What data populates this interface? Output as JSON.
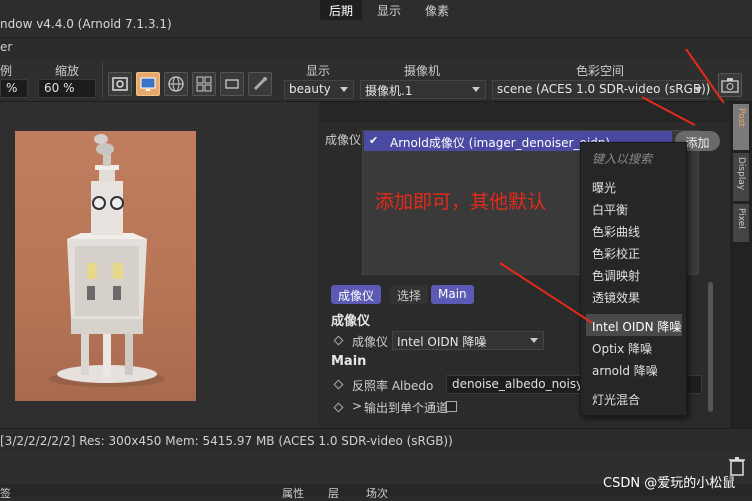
{
  "window": {
    "title": "ndow v4.4.0 (Arnold 7.1.3.1)"
  },
  "menubar": {
    "item": "er"
  },
  "toolbar": {
    "label_ratio": "例",
    "label_zoom": "缩放",
    "ratio_value": "%",
    "zoom_value": "60 %",
    "label_display": "显示",
    "label_camera": "摄像机",
    "label_colorspace": "色彩空间",
    "display_value": "beauty",
    "camera_value": "摄像机.1",
    "colorspace_value": "scene (ACES 1.0 SDR-video (sRGB))"
  },
  "tabs": [
    "后期",
    "显示",
    "像素"
  ],
  "imager": {
    "label": "成像仪",
    "list_item": "Arnold成像仪 (imager_denoiser_oidn)",
    "add_button": "添加"
  },
  "annotation": "添加即可，其他默认",
  "subtabs": [
    "成像仪",
    "选择",
    "Main"
  ],
  "props": {
    "section_imager": "成像仪",
    "imager_label": "成像仪",
    "imager_value": "Intel OIDN 降噪",
    "section_main": "Main",
    "albedo_label": "反照率 Albedo",
    "albedo_value": "denoise_albedo_noisy",
    "output_label": "输出到单个通道"
  },
  "dropdown": {
    "placeholder": "键入以搜索",
    "items": [
      "曝光",
      "白平衡",
      "色彩曲线",
      "色彩校正",
      "色调映射",
      "透镜效果",
      "Intel OIDN 降噪",
      "Optix 降噪",
      "arnold 降噪",
      "灯光混合"
    ],
    "selected": "Intel OIDN 降噪"
  },
  "sidetabs": [
    "Post",
    "Display",
    "Pixel"
  ],
  "status": "[3/2/2/2/2/2]  Res: 300x450  Mem: 5415.97 MB  (ACES 1.0 SDR-video (sRGB))",
  "bottomtabs": [
    "签",
    "属性",
    "层",
    "场次"
  ],
  "watermark": "CSDN @爱玩的小松鼠",
  "colors": {
    "accent": "#5b5bb6",
    "annotation": "#e52a1a",
    "active_button": "#e8a96a"
  }
}
